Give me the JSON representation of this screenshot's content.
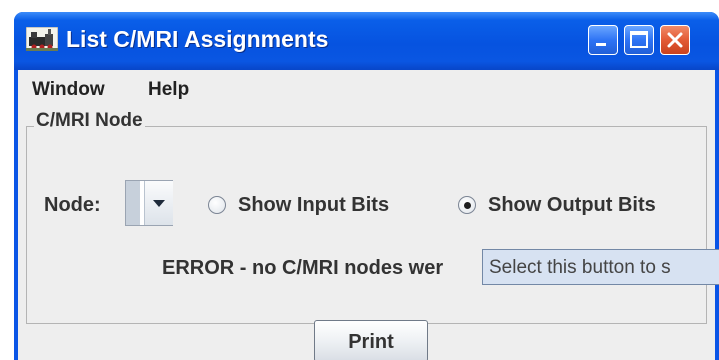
{
  "window": {
    "title": "List C/MRI Assignments",
    "icons": {
      "app": "locomotive-icon",
      "minimize": "minimize-icon",
      "maximize": "maximize-icon",
      "close": "close-icon"
    },
    "colors": {
      "titlebar": "#0653e0",
      "client_background": "#eeeeee",
      "close_button": "#e35a35"
    }
  },
  "menubar": {
    "items": [
      {
        "label": "Window"
      },
      {
        "label": "Help"
      }
    ]
  },
  "panel": {
    "title": "C/MRI Node",
    "node_label": "Node:",
    "node_selected": "",
    "radios": [
      {
        "label": "Show Input Bits",
        "selected": false
      },
      {
        "label": "Show Output Bits",
        "selected": true
      }
    ],
    "error_text": "ERROR - no C/MRI nodes wer"
  },
  "tooltip": {
    "text": "Select this button to s"
  },
  "footer": {
    "print_label": "Print"
  }
}
